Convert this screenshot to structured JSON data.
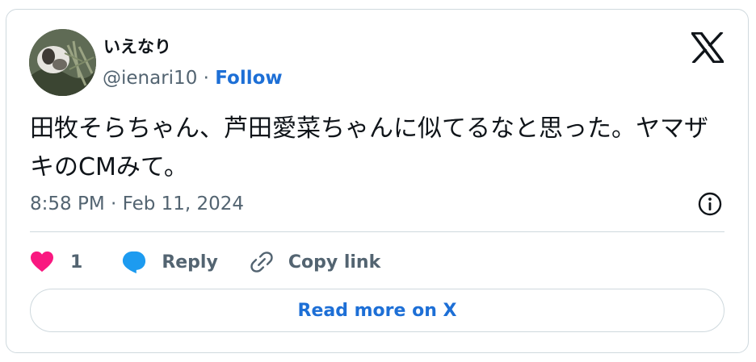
{
  "author": {
    "display_name": "いえなり",
    "handle": "@ienari10",
    "separator": "·",
    "follow_label": "Follow"
  },
  "tweet": {
    "text": "田牧そらちゃん、芦田愛菜ちゃんに似てるなと思った。ヤマザキのCMみて。",
    "timestamp": "8:58 PM · Feb 11, 2024"
  },
  "actions": {
    "like_count": "1",
    "reply_label": "Reply",
    "copy_link_label": "Copy link"
  },
  "footer": {
    "read_more_label": "Read more on X"
  },
  "colors": {
    "like": "#f91880",
    "reply": "#1d9bf0",
    "link": "#1d6fd6",
    "muted": "#536471",
    "border": "#cfd9de"
  },
  "icons": {
    "platform": "x-logo-icon",
    "info": "info-icon",
    "like": "heart-icon",
    "reply": "speech-bubble-icon",
    "copy": "link-icon"
  }
}
